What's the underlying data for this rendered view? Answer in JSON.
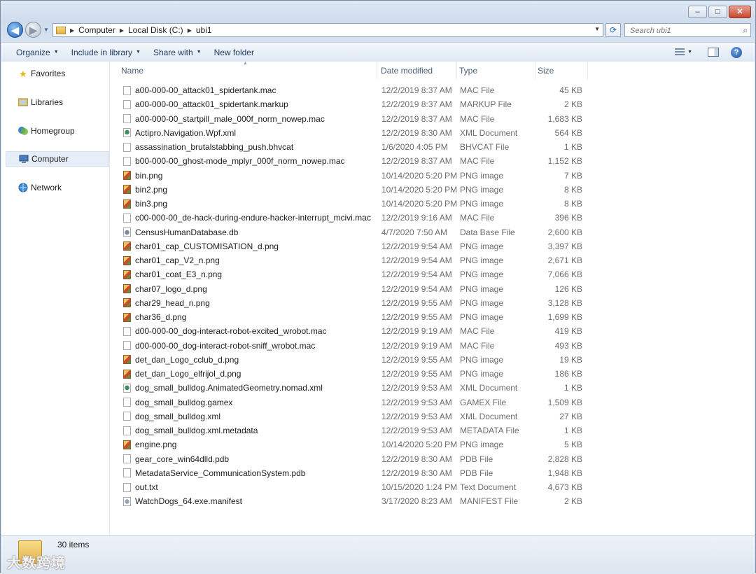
{
  "window": {
    "caption_buttons": [
      "–",
      "□",
      "✕"
    ]
  },
  "address": {
    "breadcrumbs": [
      "Computer",
      "Local Disk (C:)",
      "ubi1"
    ],
    "search_placeholder": "Search ubi1"
  },
  "toolbar": {
    "organize": "Organize",
    "include_in_library": "Include in library",
    "share_with": "Share with",
    "new_folder": "New folder"
  },
  "sidebar": {
    "items": [
      {
        "label": "Favorites",
        "icon": "star-icon"
      },
      {
        "label": "Libraries",
        "icon": "library-icon"
      },
      {
        "label": "Homegroup",
        "icon": "homegroup-icon"
      },
      {
        "label": "Computer",
        "icon": "computer-icon",
        "selected": true
      },
      {
        "label": "Network",
        "icon": "network-icon"
      }
    ]
  },
  "columns": {
    "name": "Name",
    "date": "Date modified",
    "type": "Type",
    "size": "Size"
  },
  "files": [
    {
      "name": "a00-000-00_attack01_spidertank.mac",
      "date": "12/2/2019 8:37 AM",
      "type": "MAC File",
      "size": "45 KB",
      "icon": "doc"
    },
    {
      "name": "a00-000-00_attack01_spidertank.markup",
      "date": "12/2/2019 8:37 AM",
      "type": "MARKUP File",
      "size": "2 KB",
      "icon": "doc"
    },
    {
      "name": "a00-000-00_startpill_male_000f_norm_nowep.mac",
      "date": "12/2/2019 8:37 AM",
      "type": "MAC File",
      "size": "1,683 KB",
      "icon": "doc"
    },
    {
      "name": "Actipro.Navigation.Wpf.xml",
      "date": "12/2/2019 8:30 AM",
      "type": "XML Document",
      "size": "564 KB",
      "icon": "xml"
    },
    {
      "name": "assassination_brutalstabbing_push.bhvcat",
      "date": "1/6/2020 4:05 PM",
      "type": "BHVCAT File",
      "size": "1 KB",
      "icon": "doc"
    },
    {
      "name": "b00-000-00_ghost-mode_mplyr_000f_norm_nowep.mac",
      "date": "12/2/2019 8:37 AM",
      "type": "MAC File",
      "size": "1,152 KB",
      "icon": "doc"
    },
    {
      "name": "bin.png",
      "date": "10/14/2020 5:20 PM",
      "type": "PNG image",
      "size": "7 KB",
      "icon": "png"
    },
    {
      "name": "bin2.png",
      "date": "10/14/2020 5:20 PM",
      "type": "PNG image",
      "size": "8 KB",
      "icon": "png"
    },
    {
      "name": "bin3.png",
      "date": "10/14/2020 5:20 PM",
      "type": "PNG image",
      "size": "8 KB",
      "icon": "png"
    },
    {
      "name": "c00-000-00_de-hack-during-endure-hacker-interrupt_mcivi.mac",
      "date": "12/2/2019 9:16 AM",
      "type": "MAC File",
      "size": "396 KB",
      "icon": "doc"
    },
    {
      "name": "CensusHumanDatabase.db",
      "date": "4/7/2020 7:50 AM",
      "type": "Data Base File",
      "size": "2,600 KB",
      "icon": "db"
    },
    {
      "name": "char01_cap_CUSTOMISATION_d.png",
      "date": "12/2/2019 9:54 AM",
      "type": "PNG image",
      "size": "3,397 KB",
      "icon": "png"
    },
    {
      "name": "char01_cap_V2_n.png",
      "date": "12/2/2019 9:54 AM",
      "type": "PNG image",
      "size": "2,671 KB",
      "icon": "png"
    },
    {
      "name": "char01_coat_E3_n.png",
      "date": "12/2/2019 9:54 AM",
      "type": "PNG image",
      "size": "7,066 KB",
      "icon": "png"
    },
    {
      "name": "char07_logo_d.png",
      "date": "12/2/2019 9:54 AM",
      "type": "PNG image",
      "size": "126 KB",
      "icon": "png"
    },
    {
      "name": "char29_head_n.png",
      "date": "12/2/2019 9:55 AM",
      "type": "PNG image",
      "size": "3,128 KB",
      "icon": "png"
    },
    {
      "name": "char36_d.png",
      "date": "12/2/2019 9:55 AM",
      "type": "PNG image",
      "size": "1,699 KB",
      "icon": "png"
    },
    {
      "name": "d00-000-00_dog-interact-robot-excited_wrobot.mac",
      "date": "12/2/2019 9:19 AM",
      "type": "MAC File",
      "size": "419 KB",
      "icon": "doc"
    },
    {
      "name": "d00-000-00_dog-interact-robot-sniff_wrobot.mac",
      "date": "12/2/2019 9:19 AM",
      "type": "MAC File",
      "size": "493 KB",
      "icon": "doc"
    },
    {
      "name": "det_dan_Logo_cclub_d.png",
      "date": "12/2/2019 9:55 AM",
      "type": "PNG image",
      "size": "19 KB",
      "icon": "png"
    },
    {
      "name": "det_dan_Logo_elfrijol_d.png",
      "date": "12/2/2019 9:55 AM",
      "type": "PNG image",
      "size": "186 KB",
      "icon": "png"
    },
    {
      "name": "dog_small_bulldog.AnimatedGeometry.nomad.xml",
      "date": "12/2/2019 9:53 AM",
      "type": "XML Document",
      "size": "1 KB",
      "icon": "xml"
    },
    {
      "name": "dog_small_bulldog.gamex",
      "date": "12/2/2019 9:53 AM",
      "type": "GAMEX File",
      "size": "1,509 KB",
      "icon": "doc"
    },
    {
      "name": "dog_small_bulldog.xml",
      "date": "12/2/2019 9:53 AM",
      "type": "XML Document",
      "size": "27 KB",
      "icon": "doc"
    },
    {
      "name": "dog_small_bulldog.xml.metadata",
      "date": "12/2/2019 9:53 AM",
      "type": "METADATA File",
      "size": "1 KB",
      "icon": "doc"
    },
    {
      "name": "engine.png",
      "date": "10/14/2020 5:20 PM",
      "type": "PNG image",
      "size": "5 KB",
      "icon": "png"
    },
    {
      "name": "gear_core_win64dlld.pdb",
      "date": "12/2/2019 8:30 AM",
      "type": "PDB File",
      "size": "2,828 KB",
      "icon": "doc"
    },
    {
      "name": "MetadataService_CommunicationSystem.pdb",
      "date": "12/2/2019 8:30 AM",
      "type": "PDB File",
      "size": "1,948 KB",
      "icon": "doc"
    },
    {
      "name": "out.txt",
      "date": "10/15/2020 1:24 PM",
      "type": "Text Document",
      "size": "4,673 KB",
      "icon": "doc"
    },
    {
      "name": "WatchDogs_64.exe.manifest",
      "date": "3/17/2020 8:23 AM",
      "type": "MANIFEST File",
      "size": "2 KB",
      "icon": "man"
    }
  ],
  "status": {
    "item_count": "30 items",
    "watermark": "大数跨境"
  }
}
